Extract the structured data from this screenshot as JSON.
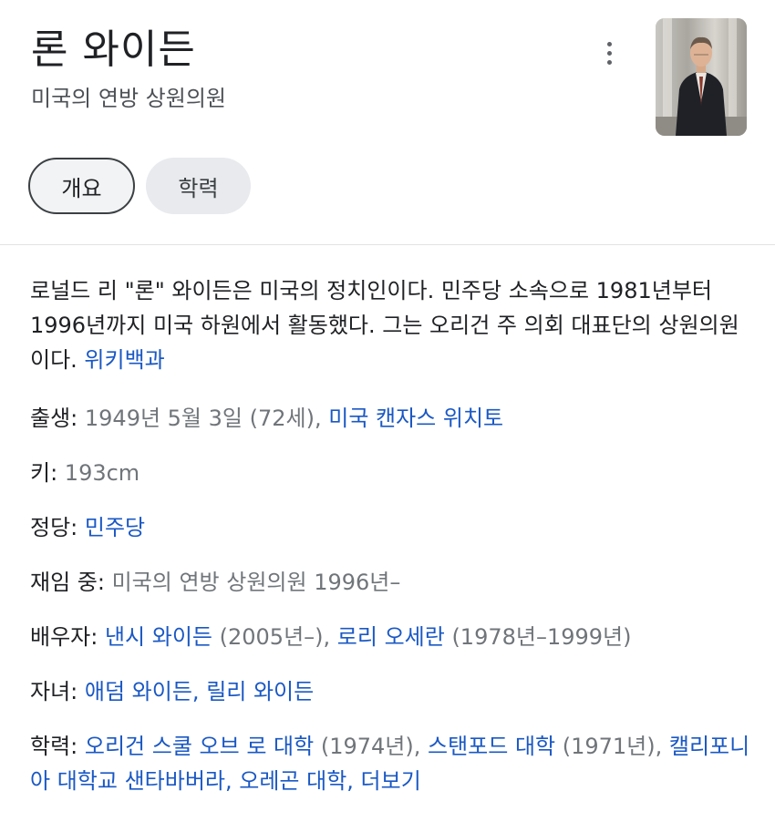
{
  "header": {
    "title": "론 와이든",
    "subtitle": "미국의 연방 상원의원",
    "more_icon": "more-vert-icon"
  },
  "tabs": [
    {
      "label": "개요",
      "selected": true
    },
    {
      "label": "학력",
      "selected": false
    }
  ],
  "description": {
    "text": "로널드 리 \"론\" 와이든은 미국의 정치인이다. 민주당 소속으로 1981년부터 1996년까지 미국 하원에서 활동했다. 그는 오리건 주 의회 대표단의 상원의원이다. ",
    "source_link": "위키백과"
  },
  "facts": {
    "born": {
      "label": "출생:",
      "value": " 1949년 5월 3일 (72세), ",
      "place_link": "미국 캔자스 위치토"
    },
    "height": {
      "label": "키:",
      "value": " 193cm"
    },
    "party": {
      "label": "정당:",
      "link": " 민주당"
    },
    "office": {
      "label": "재임 중:",
      "value": " 미국의 연방 상원의원 1996년–"
    },
    "spouse": {
      "label": "배우자:",
      "spouse1_link": "낸시 와이든",
      "spouse1_years": " (2005년–), ",
      "spouse2_link": "로리 오세란",
      "spouse2_years": " (1978년–1999년)"
    },
    "children": {
      "label": "자녀:",
      "child1_link": "애덤 와이든",
      "separator": ", ",
      "child2_link": "릴리 와이든"
    },
    "education": {
      "label": "학력:",
      "school1_link": "오리건 스쿨 오브 로 대학",
      "school1_year": " (1974년), ",
      "school2_link": "스탠포드 대학",
      "school2_year": " (1971년), ",
      "school3_link": "캘리포니아 대학교 샌타바버라",
      "separator": ", ",
      "school4_link": "오레곤 대학",
      "separator2": ", ",
      "more_link": "더보기"
    }
  },
  "colors": {
    "link": "#1a58c4",
    "muted": "#70757a",
    "text": "#202124"
  }
}
